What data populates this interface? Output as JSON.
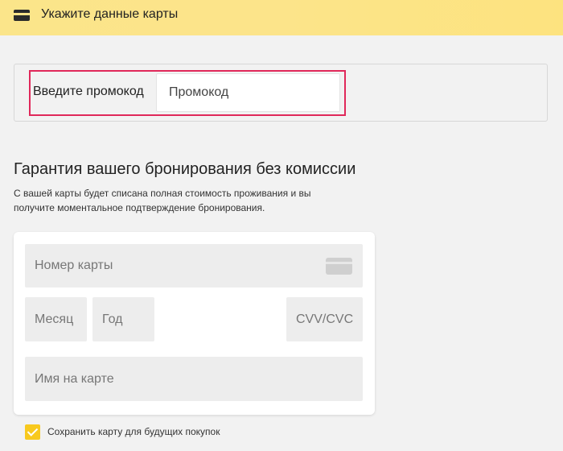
{
  "header": {
    "title": "Укажите данные карты",
    "icon": "credit-card-icon"
  },
  "promo": {
    "label": "Введите промокод",
    "placeholder": "Промокод",
    "highlight_color": "#e0285a"
  },
  "guarantee": {
    "title": "Гарантия вашего бронирования без комиссии",
    "description": "С вашей карты будет списана полная стоимость проживания и вы получите моментальное подтверждение бронирования."
  },
  "card_form": {
    "number_placeholder": "Номер карты",
    "month_placeholder": "Месяц",
    "year_placeholder": "Год",
    "cvv_placeholder": "CVV/CVC",
    "name_placeholder": "Имя на карте",
    "card_icon": "credit-card-icon"
  },
  "save_card": {
    "label": "Сохранить карту для будущих покупок",
    "checked": true,
    "accent_color": "#f8c91e"
  },
  "colors": {
    "header_bg": "#fce48a",
    "page_bg": "#f2f2f2"
  }
}
